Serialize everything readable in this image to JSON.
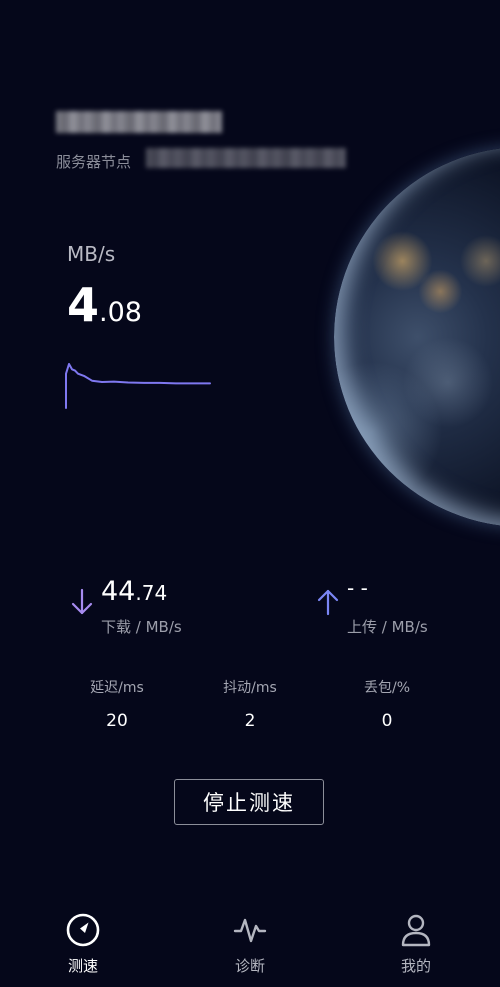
{
  "server": {
    "node_label": "服务器节点"
  },
  "speed": {
    "unit": "MB/s",
    "integer": "4",
    "decimal": ".08",
    "graph_points": [
      0.78,
      1.0,
      0.88,
      0.85,
      0.78,
      0.73,
      0.62,
      0.59,
      0.6,
      0.58,
      0.57,
      0.57,
      0.56,
      0.56,
      0.56
    ]
  },
  "download": {
    "integer": "44",
    "decimal": ".74",
    "label": "下载 / MB/s"
  },
  "upload": {
    "value": "- -",
    "label": "上传 / MB/s"
  },
  "stats": {
    "latency": {
      "label": "延迟/ms",
      "value": "20"
    },
    "jitter": {
      "label": "抖动/ms",
      "value": "2"
    },
    "loss": {
      "label": "丢包/%",
      "value": "0"
    }
  },
  "stop_button": {
    "label": "停止测速"
  },
  "nav": {
    "speed": "测速",
    "diagnose": "诊断",
    "mine": "我的"
  },
  "colors": {
    "accent": "#7f78f0",
    "download_arrow": "#a78bf0",
    "upload_arrow": "#7b86f5",
    "background": "#05071a"
  },
  "icons": {
    "speed": "speedometer-icon",
    "diagnose": "pulse-icon",
    "mine": "user-icon"
  }
}
